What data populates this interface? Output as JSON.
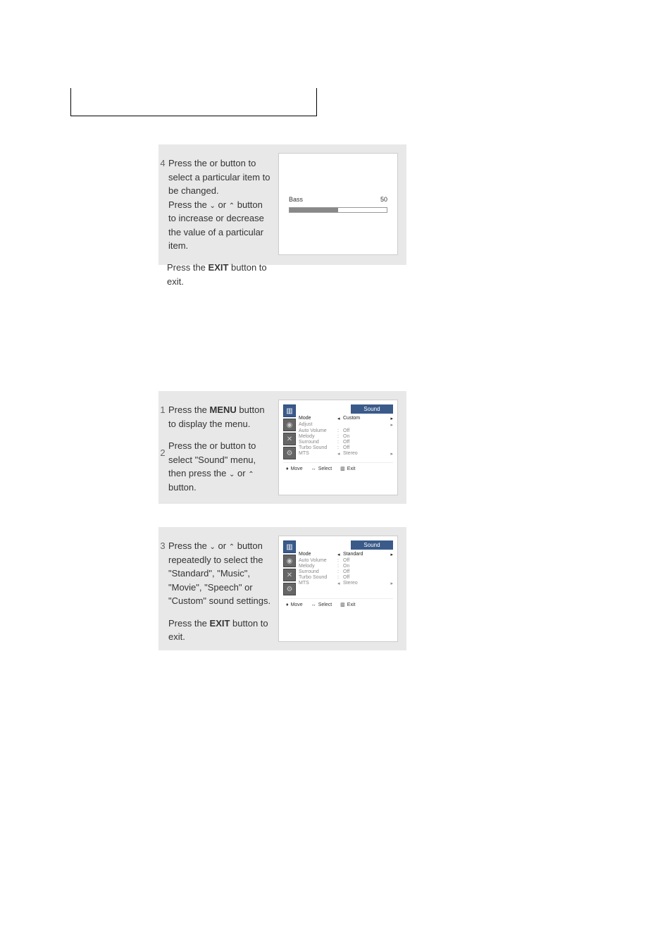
{
  "chart_data": {
    "type": "bar",
    "title": "Bass",
    "values": [
      50
    ],
    "categories": [
      "Bass"
    ],
    "xlim": [
      0,
      100
    ]
  },
  "step4": {
    "num": "4",
    "line1a": "Press the ",
    "line1b": " or ",
    "line1c": " button to select a particular item to be changed.",
    "line2a": "Press the ",
    "line2b": " or ",
    "line2c": " button to increase or decrease the value of a particular item."
  },
  "exit1": {
    "a": "Press the ",
    "b": "EXIT",
    "c": " button to exit."
  },
  "screen1": {
    "label": "Bass",
    "value": "50"
  },
  "step_b1": {
    "num": "1",
    "a": "Press the ",
    "b": "MENU",
    "c": " button to display the menu."
  },
  "step_b2": {
    "num": "2",
    "a": "Press the ",
    "b": " or ",
    "c": " button to select  \"Sound\" menu, then press the ",
    "d": " or ",
    "e": " button."
  },
  "menu1": {
    "title": "Sound",
    "rows": [
      {
        "label": "Mode",
        "arrow": "◂",
        "value": "Custom",
        "arrow2": "▸",
        "hl": true
      },
      {
        "label": "Adjust",
        "arrow": "",
        "value": "",
        "arrow2": "▸",
        "hl": false
      },
      {
        "label": "Auto Volume",
        "arrow": ":",
        "value": "Off",
        "arrow2": "",
        "hl": false
      },
      {
        "label": "Melody",
        "arrow": ":",
        "value": "On",
        "arrow2": "",
        "hl": false
      },
      {
        "label": "Surround",
        "arrow": ":",
        "value": "Off",
        "arrow2": "",
        "hl": false
      },
      {
        "label": "Turbo Sound",
        "arrow": ":",
        "value": "Off",
        "arrow2": "",
        "hl": false
      },
      {
        "label": "MTS",
        "arrow": "◂",
        "value": "Stereo",
        "arrow2": "▸",
        "hl": false
      }
    ],
    "footer": {
      "move": "Move",
      "select": "Select",
      "exit": "Exit"
    }
  },
  "step_c1": {
    "num": "3",
    "a": "Press the ",
    "b": " or ",
    "c": " button repeatedly to select the \"Standard\", \"Music\", \"Movie\", \"Speech\" or \"Custom\" sound settings."
  },
  "exit2": {
    "a": "Press the ",
    "b": "EXIT",
    "c": " button to exit."
  },
  "menu2": {
    "title": "Sound",
    "rows": [
      {
        "label": "Mode",
        "arrow": "◂",
        "value": "Standard",
        "arrow2": "▸",
        "hl": true
      },
      {
        "label": "Auto Volume",
        "arrow": ":",
        "value": "Off",
        "arrow2": "",
        "hl": false
      },
      {
        "label": "Melody",
        "arrow": ":",
        "value": "On",
        "arrow2": "",
        "hl": false
      },
      {
        "label": "Surround",
        "arrow": ":",
        "value": "Off",
        "arrow2": "",
        "hl": false
      },
      {
        "label": "Turbo Sound",
        "arrow": ":",
        "value": "Off",
        "arrow2": "",
        "hl": false
      },
      {
        "label": "MTS",
        "arrow": "◂",
        "value": "Stereo",
        "arrow2": "▸",
        "hl": false
      }
    ],
    "footer": {
      "move": "Move",
      "select": "Select",
      "exit": "Exit"
    }
  }
}
